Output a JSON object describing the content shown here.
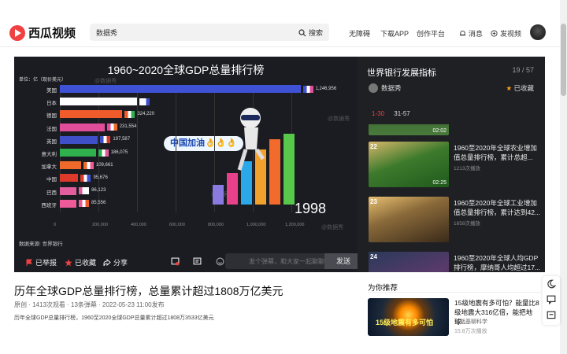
{
  "app": {
    "logo_text": "西瓜视频"
  },
  "search": {
    "value": "数据秀",
    "button_label": "搜索"
  },
  "nav": {
    "accessibility": "无障碍",
    "download": "下载APP",
    "creator": "创作平台",
    "messages": "消息",
    "upload": "发视频"
  },
  "player": {
    "chart_title": "1960~2020全球GDP总量排行榜",
    "unit_label": "单位：亿（现价美元）",
    "watermark": "@数据秀",
    "badge": "中国加油👌👌👌",
    "year": "1998",
    "source": "数据来源: 世界银行"
  },
  "chart_data": {
    "type": "bar",
    "title": "1960~2020全球GDP总量排行榜",
    "ylabel": "单位：亿（现价美元）",
    "categories": [
      "美国",
      "日本",
      "德国",
      "法国",
      "英国",
      "意大利",
      "加拿大",
      "中国",
      "巴西",
      "西班牙"
    ],
    "values": [
      1246956,
      400000,
      324220,
      231554,
      197587,
      186075,
      109661,
      95676,
      86123,
      85556
    ],
    "value_labels": [
      "1,246,956",
      "",
      "324,220",
      "231,554",
      "197,587",
      "186,075",
      "109,661",
      "95,676",
      "86,123",
      "85,556"
    ],
    "colors": [
      "#3f51d4",
      "#ffffff",
      "#ef5b2b",
      "#e04d9a",
      "#3f4fc8",
      "#2fb14e",
      "#ef6a2a",
      "#dd3a2b",
      "#e15d9e",
      "#ee5b98"
    ],
    "xticks": [
      "0",
      "200,000",
      "400,000",
      "600,000",
      "800,000",
      "1,000,000",
      "1,200,000"
    ],
    "xlim": [
      0,
      1200000
    ]
  },
  "player_bar": {
    "report": "已举报",
    "favorite": "已收藏",
    "share": "分享",
    "danmu_placeholder": "发个弹幕，和大家一起聊聊",
    "send": "发送"
  },
  "playlist": {
    "title": "世界银行发展指标",
    "count": "19 / 57",
    "author": "数据秀",
    "favorited": "已收藏",
    "tabs": [
      "1-30",
      "31-57"
    ],
    "items": [
      {
        "num": "",
        "duration": "02:02",
        "title": "",
        "views": ""
      },
      {
        "num": "22",
        "duration": "02:25",
        "title": "1960至2020年全球农业增加值总量排行榜，累计总超...",
        "views": "1213次播放"
      },
      {
        "num": "23",
        "duration": "",
        "title": "1960至2020年全球工业增加值总量排行榜，累计达到42...",
        "views": "1658次播放"
      },
      {
        "num": "24",
        "duration": "",
        "title": "1960至2020年全球人均GDP排行榜，摩纳哥人均超过17...",
        "views": ""
      }
    ]
  },
  "video": {
    "title": "历年全球GDP总量排行榜，总量累计超过1808万亿美元",
    "meta": "原创 · 1413次观看 · 13条弹幕 · 2022-05-23 11:00发布",
    "desc": "历年全球GDP总量排行榜，1960至2020全球GDP总量累计超过1808万3533亿美元"
  },
  "recommend": {
    "heading": "为你推荐",
    "thumb_text": "15级地震有多可怕",
    "title": "15级地震有多可怕？能量比8级地震大316亿倍，能把地球...",
    "author": "免斯基聊科学",
    "views": "15.8万次播放"
  }
}
